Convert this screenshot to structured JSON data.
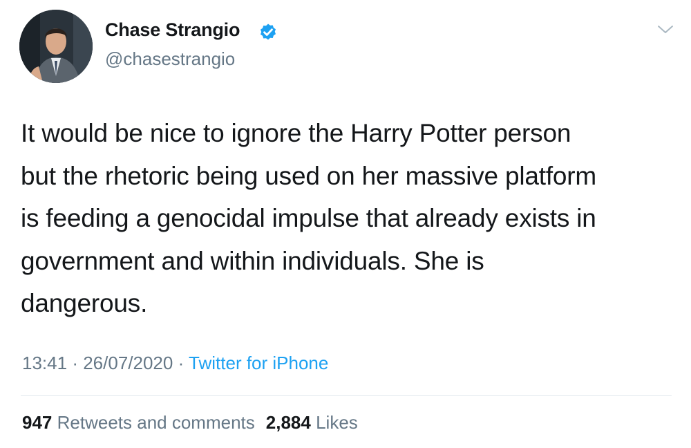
{
  "author": {
    "display_name": "Chase Strangio",
    "handle": "@chasestrangio",
    "verified": true
  },
  "tweet": {
    "text_lines": [
      "It would be nice to ignore the Harry Potter person",
      "but the rhetoric being used on her massive platform",
      "is feeding a genocidal impulse that already exists in",
      "government and within individuals. She is",
      "dangerous."
    ],
    "time": "13:41",
    "separator": "·",
    "date": "26/07/2020",
    "source": "Twitter for iPhone"
  },
  "stats": {
    "retweets_count": "947",
    "retweets_label": "Retweets and comments",
    "likes_count": "2,884",
    "likes_label": "Likes"
  },
  "colors": {
    "text": "#14171a",
    "secondary": "#657786",
    "accent": "#1da1f2",
    "divider": "#e1e8ed"
  },
  "icons": {
    "verified": "verified-badge-icon",
    "menu": "chevron-down-icon"
  }
}
